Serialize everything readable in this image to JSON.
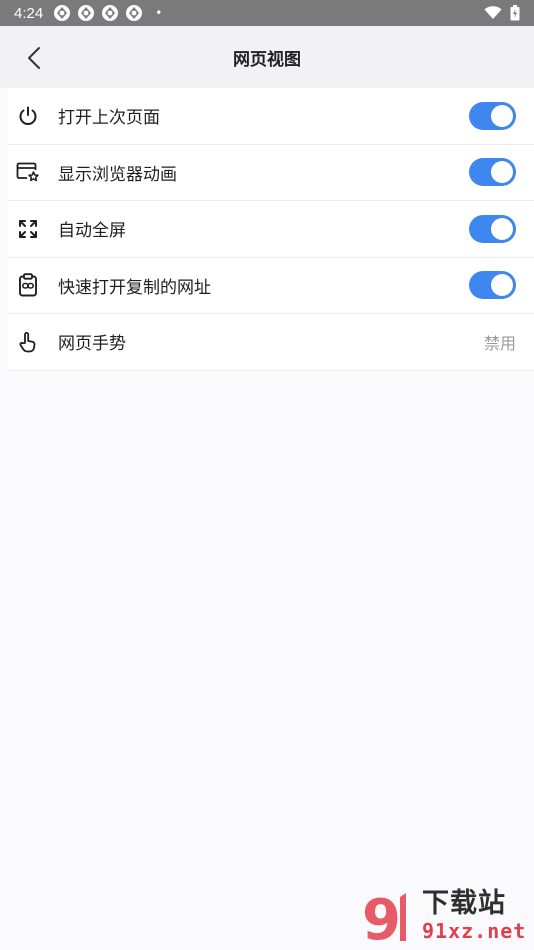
{
  "status_bar": {
    "time": "4:24",
    "notification_icons": [
      "app-icon",
      "app-icon",
      "app-icon",
      "app-icon"
    ],
    "dot": "•"
  },
  "header": {
    "title": "网页视图"
  },
  "settings": [
    {
      "label": "打开上次页面",
      "icon": "power-icon",
      "type": "toggle",
      "on": true
    },
    {
      "label": "显示浏览器动画",
      "icon": "browser-star-icon",
      "type": "toggle",
      "on": true
    },
    {
      "label": "自动全屏",
      "icon": "fullscreen-icon",
      "type": "toggle",
      "on": true
    },
    {
      "label": "快速打开复制的网址",
      "icon": "clipboard-link-icon",
      "type": "toggle",
      "on": true
    },
    {
      "label": "网页手势",
      "icon": "hand-gesture-icon",
      "type": "value",
      "value": "禁用"
    }
  ],
  "watermark": {
    "brand": "下载站",
    "url": "91xz.net"
  },
  "colors": {
    "accent": "#3e86f0",
    "status_bar": "#7a7a7a",
    "header_bg": "#f2f2f4",
    "watermark_red": "#e02a3a"
  }
}
